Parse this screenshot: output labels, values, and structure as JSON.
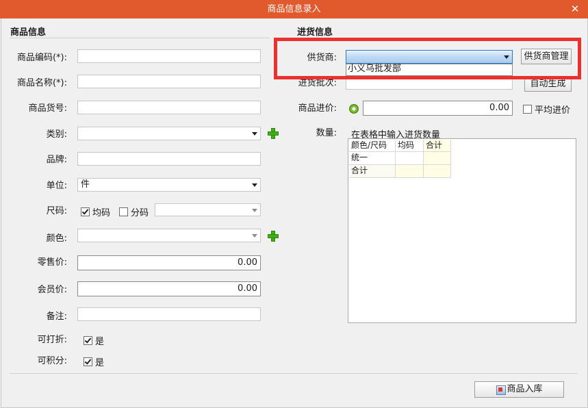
{
  "window": {
    "title": "商品信息录入"
  },
  "left": {
    "section_title": "商品信息",
    "code_label": "商品编码(*):",
    "name_label": "商品名称(*):",
    "article_label": "商品货号:",
    "category_label": "类别:",
    "brand_label": "品牌:",
    "unit_label": "单位:",
    "unit_value": "件",
    "size_label": "尺码:",
    "size_uniform_label": "均码",
    "size_split_label": "分码",
    "color_label": "颜色:",
    "retail_label": "零售价:",
    "retail_value": "0.00",
    "member_label": "会员价:",
    "member_value": "0.00",
    "remark_label": "备注:",
    "discount_label": "可打折:",
    "discount_value": "是",
    "points_label": "可积分:",
    "points_value": "是"
  },
  "right": {
    "section_title": "进货信息",
    "supplier_label": "供货商:",
    "supplier_manage_button": "供货商管理",
    "supplier_options": [
      "小义乌批发部"
    ],
    "batch_label": "进货批次:",
    "auto_generate_button": "自动生成",
    "cost_label": "商品进价:",
    "cost_value": "0.00",
    "avg_cost_label": "平均进价",
    "qty_label": "数量:",
    "qty_group_title": "在表格中输入进货数量",
    "grid": {
      "headers": [
        "颜色/尺码",
        "均码",
        "合计"
      ],
      "rows": [
        [
          "统一",
          "",
          ""
        ],
        [
          "合计",
          "",
          ""
        ]
      ]
    }
  },
  "footer": {
    "stock_in_button": "商品入库"
  }
}
